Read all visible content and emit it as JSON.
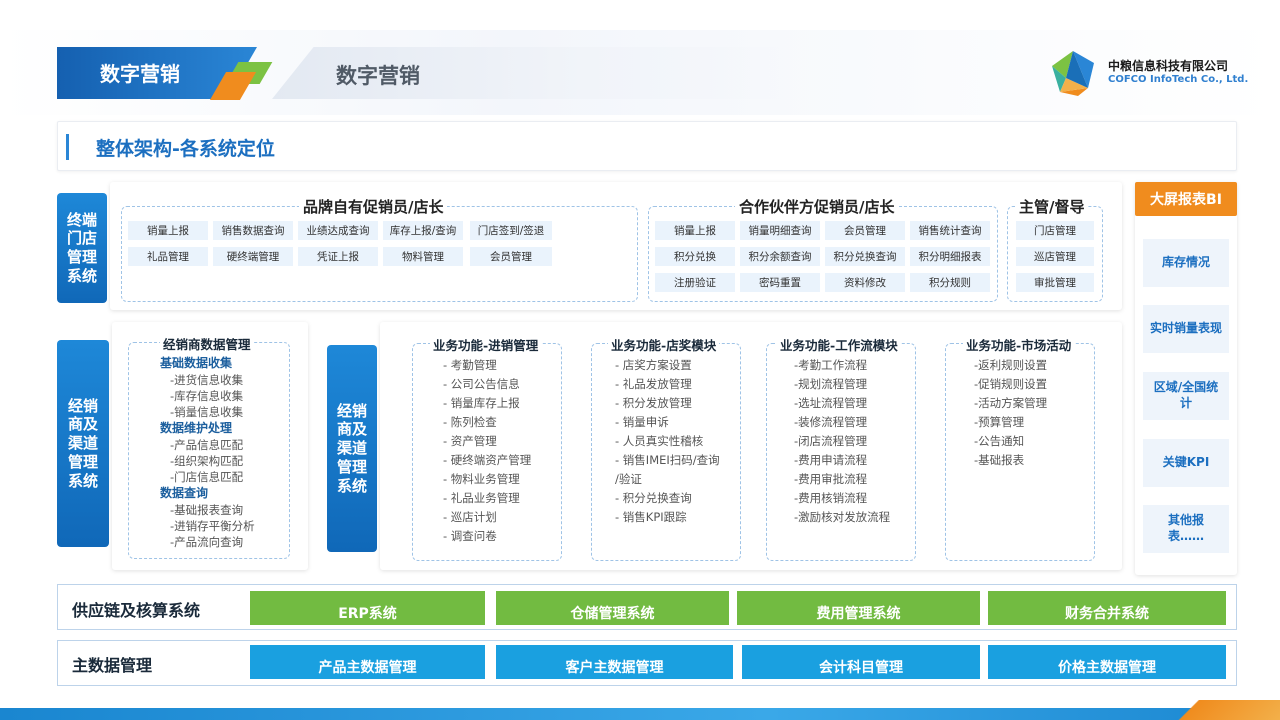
{
  "header": {
    "tab_main": "数字营销",
    "tab_second": "数字营销",
    "logo_cn": "中粮信息科技有限公司",
    "logo_en": "COFCO InfoTech Co., Ltd.",
    "section_title": "整体架构-各系统定位"
  },
  "terminal": {
    "label": "终端门店管理系统",
    "brand": {
      "title": "品牌自有促销员/店长",
      "row1": [
        "销量上报",
        "销售数据查询",
        "业绩达成查询",
        "库存上报/查询",
        "门店签到/签退"
      ],
      "row2": [
        "礼品管理",
        "硬终端管理",
        "凭证上报",
        "物料管理",
        "会员管理"
      ]
    },
    "partner": {
      "title": "合作伙伴方促销员/店长",
      "row1": [
        "销量上报",
        "销量明细查询",
        "会员管理",
        "销售统计查询"
      ],
      "row2": [
        "积分兑换",
        "积分余额查询",
        "积分兑换查询",
        "积分明细报表"
      ],
      "row3": [
        "注册验证",
        "密码重置",
        "资料修改",
        "积分规则"
      ]
    },
    "supervisor": {
      "title": "主管/督导",
      "items": [
        "门店管理",
        "巡店管理",
        "审批管理"
      ]
    }
  },
  "dealer": {
    "label": "经销商及渠道管理系统",
    "data_mgmt": {
      "title": "经销商数据管理",
      "collect_title": "基础数据收集",
      "collect": [
        "-进货信息收集",
        "-库存信息收集",
        "-销量信息收集"
      ],
      "maintain_title": "数据维护处理",
      "maintain": [
        "-产品信息匹配",
        "-组织架构匹配",
        "-门店信息匹配"
      ],
      "query_title": "数据查询",
      "query": [
        "-基础报表查询",
        "-进销存平衡分析",
        "-产品流向查询"
      ]
    }
  },
  "channel": {
    "label": "经销商及渠道管理系统",
    "modules": [
      {
        "title": "业务功能-进销管理",
        "items": [
          "- 考勤管理",
          "- 公司公告信息",
          "- 销量库存上报",
          "- 陈列检查",
          "- 资产管理",
          "- 硬终端资产管理",
          "- 物料业务管理",
          "- 礼品业务管理",
          "- 巡店计划",
          "- 调查问卷"
        ]
      },
      {
        "title": "业务功能-店奖模块",
        "items": [
          "- 店奖方案设置",
          "- 礼品发放管理",
          "- 积分发放管理",
          "- 销量申诉",
          "- 人员真实性稽核",
          "- 销售IMEI扫码/查询",
          "/验证",
          "- 积分兑换查询",
          "- 销售KPI跟踪"
        ]
      },
      {
        "title": "业务功能-工作流模块",
        "items": [
          "-考勤工作流程",
          "-规划流程管理",
          "-选址流程管理",
          "-装修流程管理",
          "-闭店流程管理",
          "-费用申请流程",
          "-费用审批流程",
          "-费用核销流程",
          "-激励核对发放流程"
        ]
      },
      {
        "title": "业务功能-市场活动",
        "items": [
          "-返利规则设置",
          "-促销规则设置",
          "-活动方案管理",
          "-预算管理",
          "-公告通知",
          "-基础报表"
        ]
      }
    ]
  },
  "bi": {
    "title": "大屏报表BI",
    "items": [
      "库存情况",
      "实时销量表现",
      "区域/全国统计",
      "关键KPI",
      "其他报表……"
    ]
  },
  "supply": {
    "label": "供应链及核算系统",
    "bars": [
      "ERP系统",
      "仓储管理系统",
      "费用管理系统",
      "财务合并系统"
    ]
  },
  "master": {
    "label": "主数据管理",
    "bars": [
      "产品主数据管理",
      "客户主数据管理",
      "会计科目管理",
      "价格主数据管理"
    ]
  },
  "colors": {
    "primary_blue": "#1c6fc0",
    "orange": "#f08c1e",
    "green": "#72bb41",
    "cyan": "#1aa0e0"
  }
}
